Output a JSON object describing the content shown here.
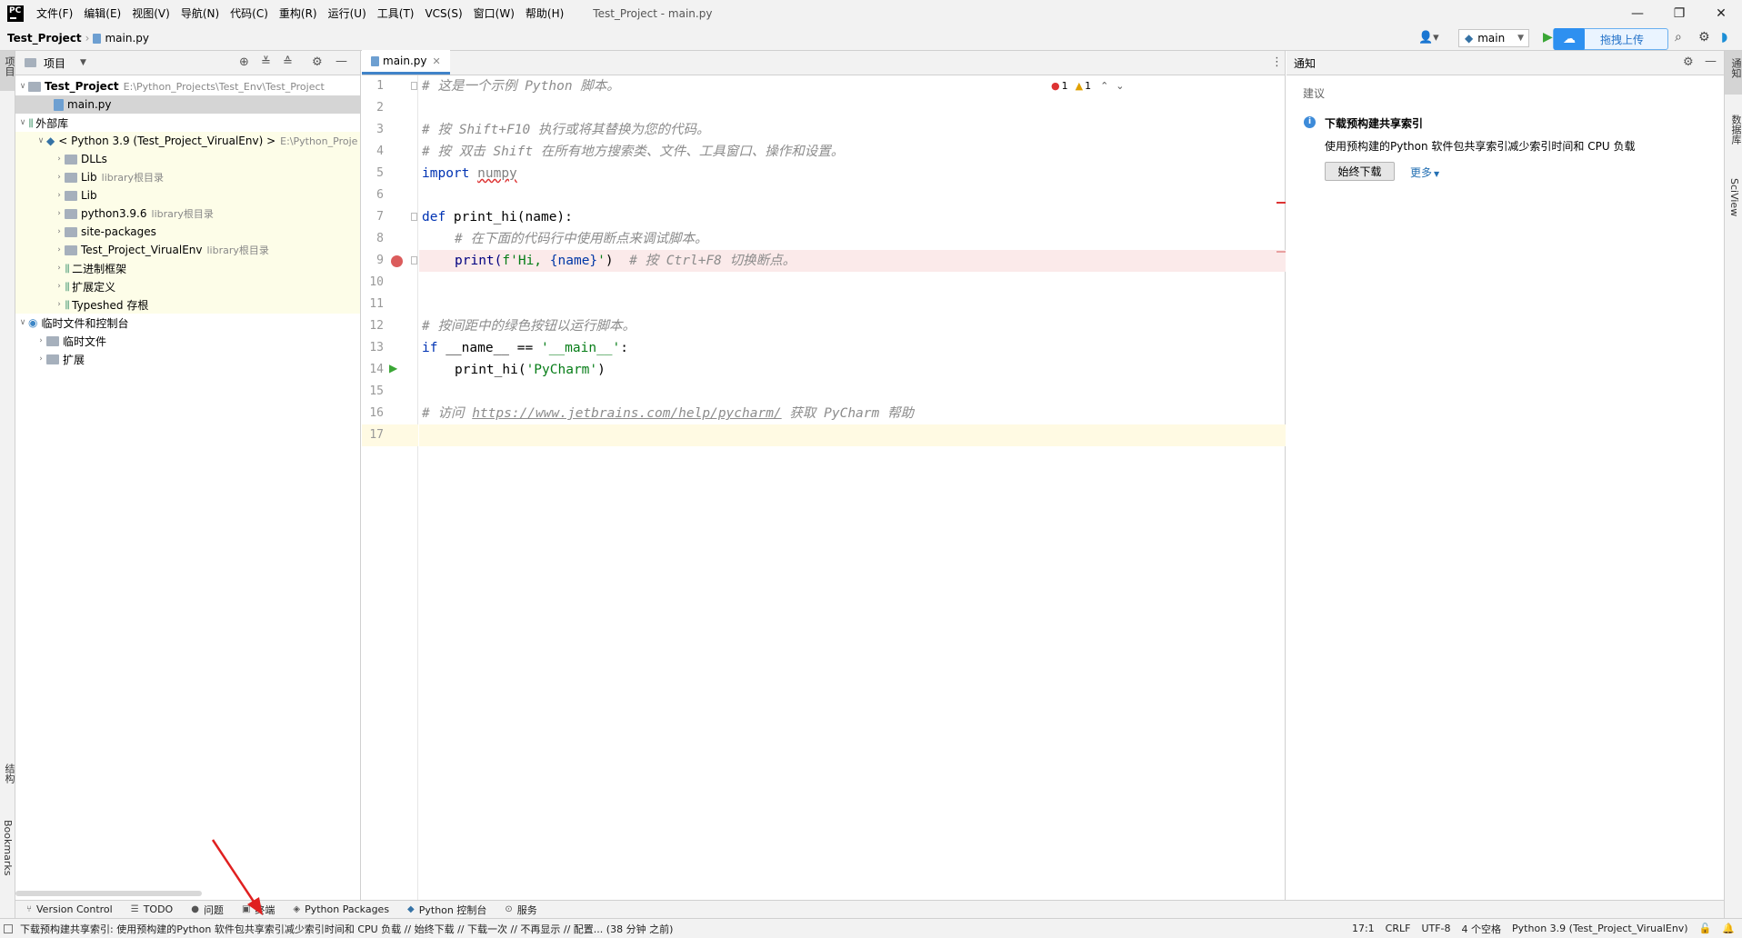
{
  "menu": [
    "文件(F)",
    "编辑(E)",
    "视图(V)",
    "导航(N)",
    "代码(C)",
    "重构(R)",
    "运行(U)",
    "工具(T)",
    "VCS(S)",
    "窗口(W)",
    "帮助(H)"
  ],
  "window_title": "Test_Project - main.py",
  "logo_text": "PC",
  "breadcrumb": {
    "project": "Test_Project",
    "file": "main.py"
  },
  "toolbar": {
    "branch": "main",
    "upload_label": "拖拽上传"
  },
  "left_strip": {
    "project": "项目",
    "structure": "结构",
    "bookmarks": "Bookmarks"
  },
  "right_strip": {
    "notifications": "通知",
    "database": "数据库",
    "sciview": "SciView"
  },
  "project_panel": {
    "title": "项目",
    "tree": [
      {
        "label": "Test_Project",
        "hint": "E:\\Python_Projects\\Test_Env\\Test_Project",
        "bold": true
      },
      {
        "label": "main.py",
        "hint": ""
      },
      {
        "label": "外部库",
        "hint": ""
      },
      {
        "label": "< Python 3.9 (Test_Project_VirualEnv) >",
        "hint": "E:\\Python_Proje"
      },
      {
        "label": "DLLs",
        "hint": ""
      },
      {
        "label": "Lib",
        "hint": "library根目录"
      },
      {
        "label": "Lib",
        "hint": ""
      },
      {
        "label": "python3.9.6",
        "hint": "library根目录"
      },
      {
        "label": "site-packages",
        "hint": ""
      },
      {
        "label": "Test_Project_VirualEnv",
        "hint": "library根目录"
      },
      {
        "label": "二进制框架",
        "hint": ""
      },
      {
        "label": "扩展定义",
        "hint": ""
      },
      {
        "label": "Typeshed 存根",
        "hint": ""
      },
      {
        "label": "临时文件和控制台",
        "hint": ""
      },
      {
        "label": "临时文件",
        "hint": ""
      },
      {
        "label": "扩展",
        "hint": ""
      }
    ]
  },
  "editor": {
    "tab": "main.py",
    "errors": "1",
    "warnings": "1",
    "line_numbers": [
      "1",
      "2",
      "3",
      "4",
      "5",
      "6",
      "7",
      "8",
      "9",
      "10",
      "11",
      "12",
      "13",
      "14",
      "15",
      "16",
      "17"
    ],
    "code": {
      "l1": "# 这是一个示例 Python 脚本。",
      "l3": "# 按 Shift+F10 执行或将其替换为您的代码。",
      "l4": "# 按 双击 Shift 在所有地方搜索类、文件、工具窗口、操作和设置。",
      "l5_kw": "import",
      "l5_mod": "numpy",
      "l7_kw": "def",
      "l7_rest": " print_hi(name):",
      "l8": "# 在下面的代码行中使用断点来调试脚本。",
      "l9_a": "print(",
      "l9_str": "f'Hi, ",
      "l9_var": "{name}",
      "l9_str2": "'",
      "l9_b": ")",
      "l9_cmt": "# 按 Ctrl+F8 切换断点。",
      "l12": "# 按间距中的绿色按钮以运行脚本。",
      "l13_kw": "if",
      "l13_mid": " __name__ == ",
      "l13_str": "'__main__'",
      "l13_end": ":",
      "l14_a": "print_hi(",
      "l14_str": "'PyCharm'",
      "l14_b": ")",
      "l16_a": "# 访问 ",
      "l16_link": "https://www.jetbrains.com/help/pycharm/",
      "l16_b": " 获取 PyCharm 帮助"
    }
  },
  "notifications": {
    "title": "通知",
    "section": "建议",
    "heading": "下载预构建共享索引",
    "body": "使用预构建的Python 软件包共享索引减少索引时间和 CPU 负载",
    "primary_button": "始终下载",
    "more": "更多"
  },
  "bottom_tools": [
    "Version Control",
    "TODO",
    "问题",
    "终端",
    "Python Packages",
    "Python 控制台",
    "服务"
  ],
  "status": {
    "message": "下载预构建共享索引: 使用预构建的Python 软件包共享索引减少索引时间和 CPU 负载 // 始终下载 // 下载一次 // 不再显示 // 配置... (38 分钟 之前)",
    "position": "17:1",
    "line_sep": "CRLF",
    "encoding": "UTF-8",
    "indent": "4 个空格",
    "interpreter": "Python 3.9 (Test_Project_VirualEnv)"
  },
  "colors": {
    "accent": "#4083c9",
    "breakpoint": "#db5c5c",
    "lib_bg": "#fdfde8",
    "bp_line": "#fbeaea",
    "red_arrow": "#e02020"
  }
}
